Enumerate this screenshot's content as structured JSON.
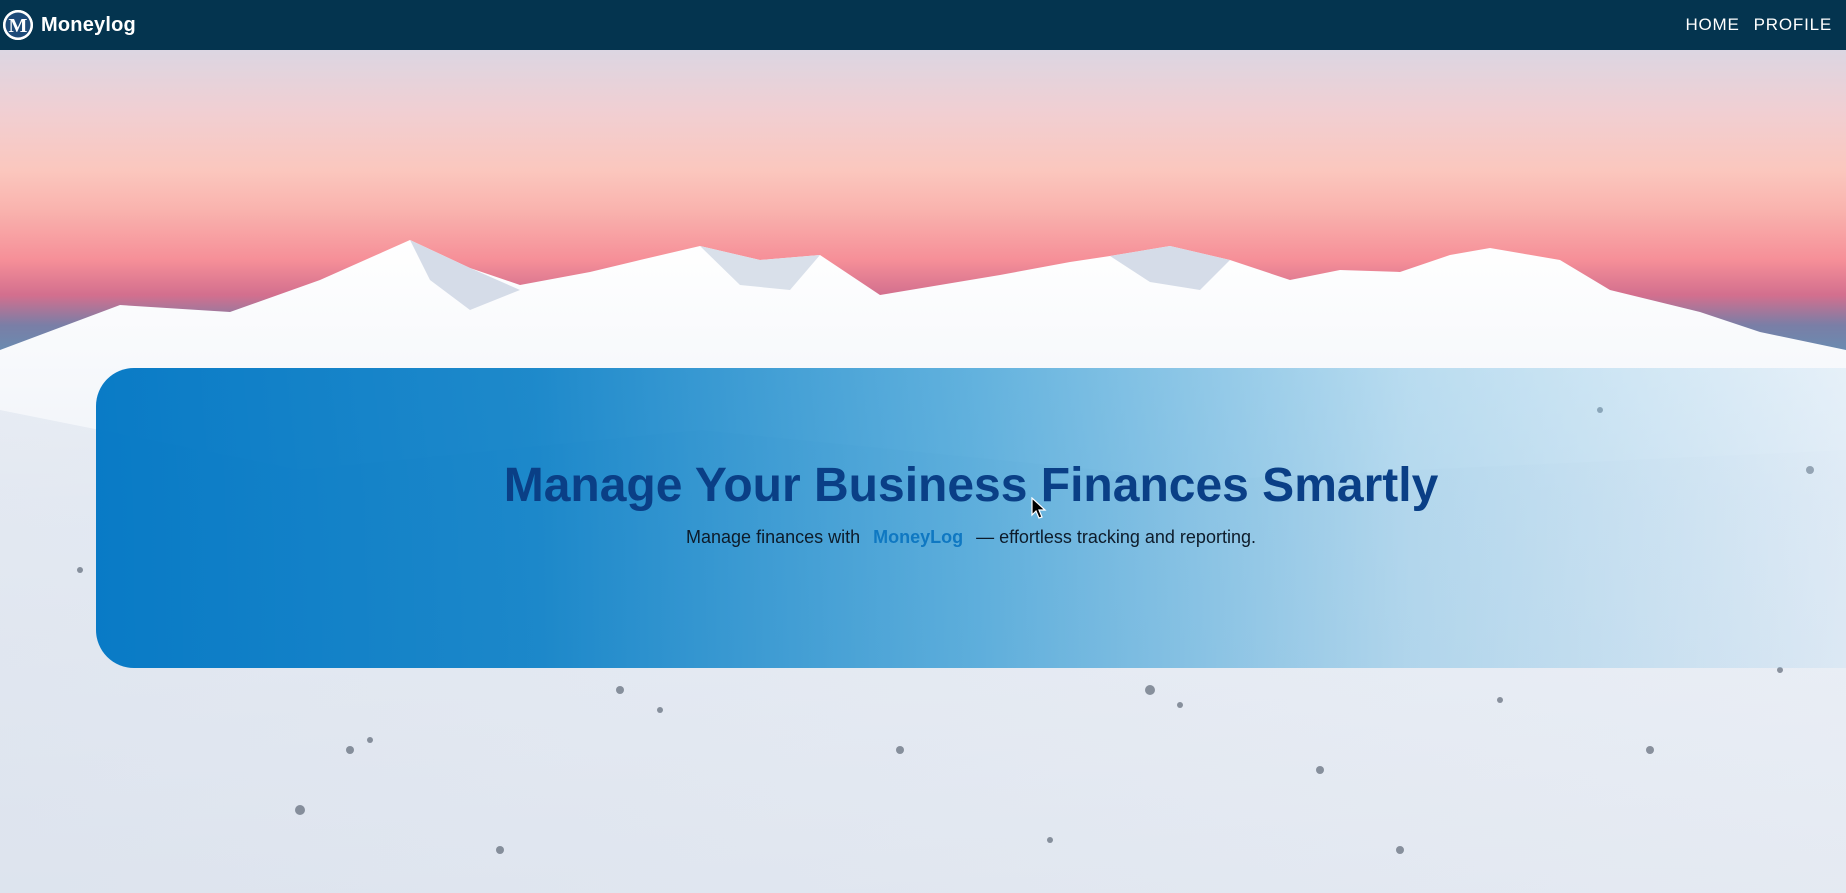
{
  "app": {
    "brand_name": "Moneylog",
    "logo_letter": "M"
  },
  "nav": {
    "items": [
      {
        "label": "HOME"
      },
      {
        "label": "PROFILE"
      }
    ]
  },
  "hero": {
    "title": "Manage Your Business Finances Smartly",
    "subtitle_before": "Manage finances with",
    "subtitle_brand": "MoneyLog",
    "subtitle_after": "— effortless tracking and reporting."
  },
  "colors": {
    "navbar": "#04344f",
    "title": "#0a3f86",
    "brand_link": "#0f78c2",
    "card": "#0076c4"
  }
}
